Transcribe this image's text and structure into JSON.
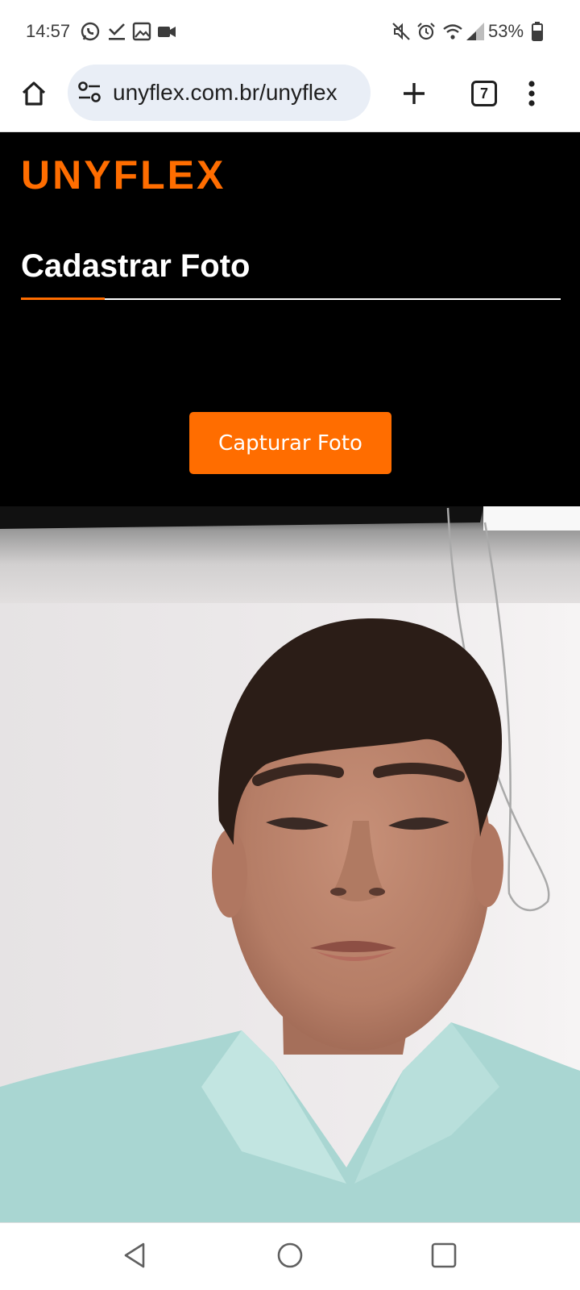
{
  "status_bar": {
    "time": "14:57",
    "left_icons": [
      "whatsapp-icon",
      "check-download-icon",
      "image-icon",
      "video-camera-icon"
    ],
    "right_icons": [
      "mute-icon",
      "alarm-icon",
      "wifi-icon",
      "signal-icon",
      "battery-icon"
    ],
    "battery": "53%"
  },
  "browser": {
    "url": "unyflex.com.br/unyflex",
    "tab_count": "7",
    "icons": [
      "home-icon",
      "site-settings-icon",
      "new-tab-plus-icon",
      "menu-dots-icon"
    ]
  },
  "page": {
    "brand": "UNYFLEX",
    "title": "Cadastrar Foto",
    "capture_button": "Capturar Foto",
    "accent_color": "#ff6d00",
    "background_color": "#000000"
  },
  "nav": {
    "icons": [
      "back-icon",
      "home-circle-icon",
      "recents-icon"
    ]
  }
}
